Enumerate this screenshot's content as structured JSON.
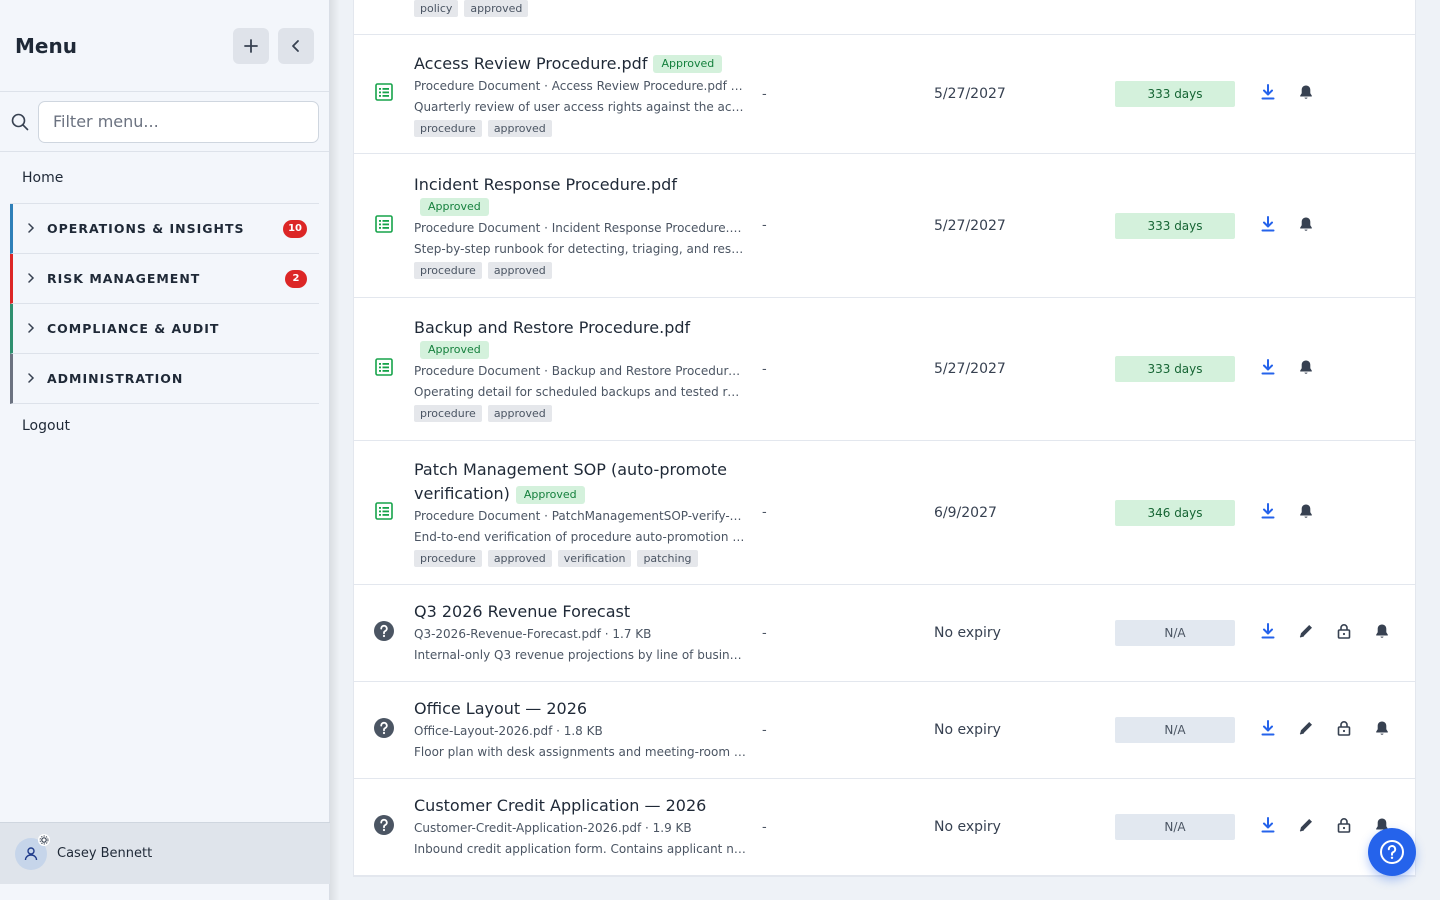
{
  "sidebar": {
    "title": "Menu",
    "search_placeholder": "Filter menu...",
    "home_label": "Home",
    "groups": [
      {
        "label": "OPERATIONS & INSIGHTS",
        "badge": "10",
        "accent": "#2e7fb8"
      },
      {
        "label": "RISK MANAGEMENT",
        "badge": "2",
        "accent": "#dc2626"
      },
      {
        "label": "COMPLIANCE & AUDIT",
        "badge": "",
        "accent": "#2f8f6f"
      },
      {
        "label": "ADMINISTRATION",
        "badge": "",
        "accent": "#6b7280"
      }
    ],
    "logout_label": "Logout",
    "user_name": "Casey Bennett"
  },
  "top_partial_tags": [
    "policy",
    "approved"
  ],
  "documents": [
    {
      "icon": "document-list-icon",
      "title": "Access Review Procedure.pdf",
      "status": "Approved",
      "meta": "Procedure Document · Access Review Procedure.pdf · 7...",
      "desc": "Quarterly review of user access rights against the acces...",
      "tags": [
        "procedure",
        "approved"
      ],
      "owner": "-",
      "expiry": "5/27/2027",
      "days": "333 days",
      "days_style": "green",
      "actions": [
        "download-icon",
        "bell-icon"
      ]
    },
    {
      "icon": "document-list-icon",
      "title": "Incident Response Procedure.pdf",
      "status": "Approved",
      "meta": "Procedure Document · Incident Response Procedure.pdf...",
      "desc": "Step-by-step runbook for detecting, triaging, and respo...",
      "tags": [
        "procedure",
        "approved"
      ],
      "owner": "-",
      "expiry": "5/27/2027",
      "days": "333 days",
      "days_style": "green",
      "actions": [
        "download-icon",
        "bell-icon"
      ]
    },
    {
      "icon": "document-list-icon",
      "title": "Backup and Restore Procedure.pdf",
      "status": "Approved",
      "meta": "Procedure Document · Backup and Restore Procedure.p...",
      "desc": "Operating detail for scheduled backups and tested resto...",
      "tags": [
        "procedure",
        "approved"
      ],
      "owner": "-",
      "expiry": "5/27/2027",
      "days": "333 days",
      "days_style": "green",
      "actions": [
        "download-icon",
        "bell-icon"
      ]
    },
    {
      "icon": "document-list-icon",
      "title": "Patch Management SOP (auto-promote verification)",
      "status": "Approved",
      "meta": "Procedure Document · PatchManagementSOP-verify-v1....",
      "desc": "End-to-end verification of procedure auto-promotion fro...",
      "tags": [
        "procedure",
        "approved",
        "verification",
        "patching"
      ],
      "owner": "-",
      "expiry": "6/9/2027",
      "days": "346 days",
      "days_style": "green",
      "actions": [
        "download-icon",
        "bell-icon"
      ]
    },
    {
      "icon": "question-circle-icon",
      "title": "Q3 2026 Revenue Forecast",
      "status": "",
      "meta": "Q3-2026-Revenue-Forecast.pdf · 1.7 KB",
      "desc": "Internal-only Q3 revenue projections by line of business ...",
      "tags": [],
      "owner": "-",
      "expiry": "No expiry",
      "days": "N/A",
      "days_style": "gray",
      "actions": [
        "download-icon",
        "pencil-icon",
        "lock-icon",
        "bell-icon"
      ]
    },
    {
      "icon": "question-circle-icon",
      "title": "Office Layout — 2026",
      "status": "",
      "meta": "Office-Layout-2026.pdf · 1.8 KB",
      "desc": "Floor plan with desk assignments and meeting-room ma...",
      "tags": [],
      "owner": "-",
      "expiry": "No expiry",
      "days": "N/A",
      "days_style": "gray",
      "actions": [
        "download-icon",
        "pencil-icon",
        "lock-icon",
        "bell-icon"
      ]
    },
    {
      "icon": "question-circle-icon",
      "title": "Customer Credit Application — 2026",
      "status": "",
      "meta": "Customer-Credit-Application-2026.pdf · 1.9 KB",
      "desc": "Inbound credit application form. Contains applicant nam...",
      "tags": [],
      "owner": "-",
      "expiry": "No expiry",
      "days": "N/A",
      "days_style": "gray",
      "actions": [
        "download-icon",
        "pencil-icon",
        "lock-icon",
        "bell-icon"
      ]
    }
  ],
  "colors": {
    "accent_blue": "#2563eb",
    "approved_green": "#15803d",
    "badge_red": "#dc2626"
  }
}
